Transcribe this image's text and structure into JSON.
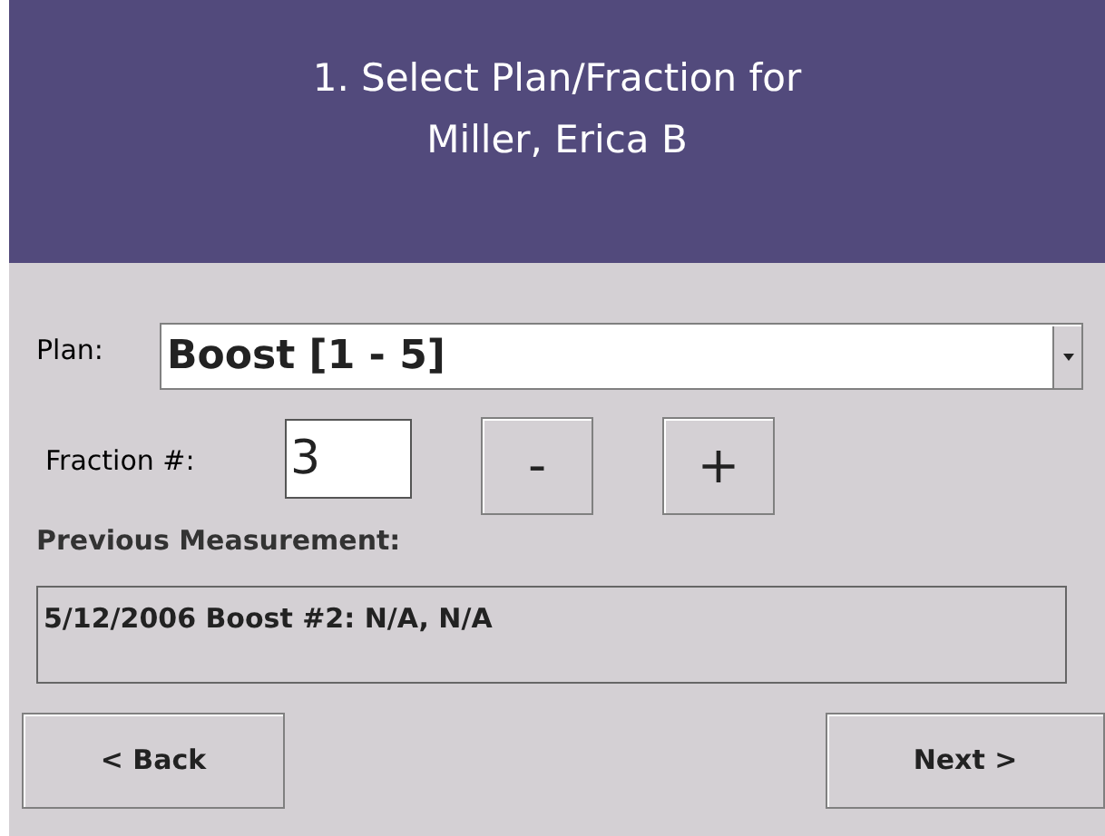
{
  "header": {
    "title_lines": [
      "1. Select Plan/Fraction for",
      "Miller, Erica B"
    ]
  },
  "plan": {
    "label": "Plan:",
    "value": "Boost [1 - 5]"
  },
  "fraction": {
    "label": "Fraction #:",
    "value": "3",
    "buttons": [
      "-",
      "+"
    ]
  },
  "previous": {
    "label": "Previous Measurement:",
    "text": "5/12/2006 Boost #2: N/A, N/A"
  },
  "nav": {
    "back": "< Back",
    "next": "Next >"
  }
}
